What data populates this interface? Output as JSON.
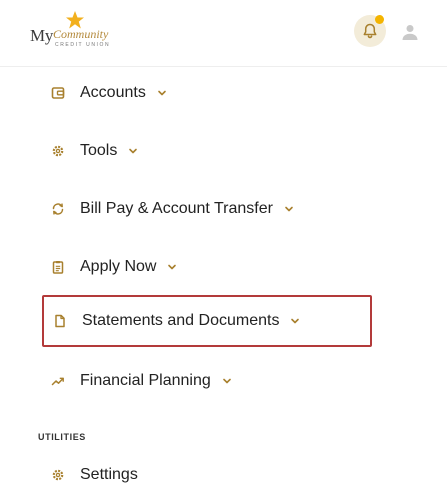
{
  "header": {
    "logo": {
      "my": "My",
      "community": "Community",
      "cu": "CREDIT UNION"
    },
    "notification_dot_color": "#f4b400",
    "bell_bg_color": "#f3ecd9"
  },
  "accent_color": "#a8802e",
  "highlight_color": "#b33a3a",
  "menu": {
    "items": [
      {
        "label": "Accounts",
        "icon": "wallet-icon"
      },
      {
        "label": "Tools",
        "icon": "gear-icon"
      },
      {
        "label": "Bill Pay & Account Transfer",
        "icon": "transfer-icon"
      },
      {
        "label": "Apply Now",
        "icon": "clipboard-icon"
      },
      {
        "label": "Statements and Documents",
        "icon": "document-icon"
      },
      {
        "label": "Financial Planning",
        "icon": "trending-icon"
      }
    ],
    "section_utilities": "UTILITIES",
    "utilities": [
      {
        "label": "Settings",
        "icon": "gear-icon"
      }
    ]
  }
}
